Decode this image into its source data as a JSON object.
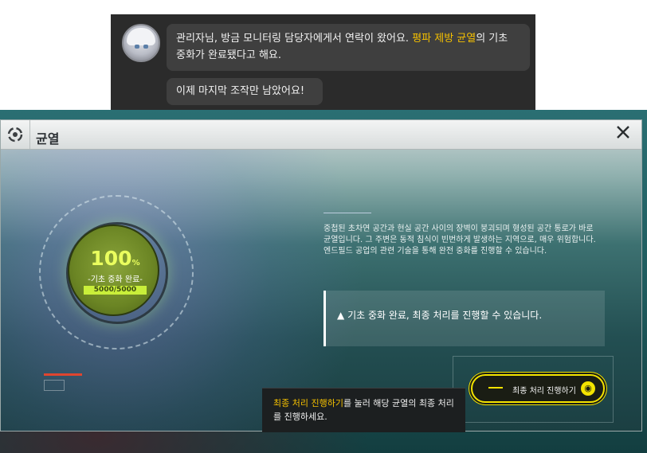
{
  "chat": {
    "message1_part1": "관리자님, 방금 모니터링 담당자에게서 연락이 왔어요. ",
    "message1_highlight": "평파 제방 균열",
    "message1_part2": "의 기초 중화가 완료됐다고 해요.",
    "message2": "이제 마지막 조작만 남았어요!"
  },
  "window": {
    "title": "균열",
    "logo_icon": "swirl-logo-icon",
    "close_icon": "close-icon"
  },
  "progress": {
    "percent_value": "100",
    "percent_sign": "%",
    "status_label": "-기초 중화 완료-",
    "counter": "5000/5000",
    "fraction": 1.0
  },
  "description": "중첩된 초차연 공간과 현실 공간 사이의 장벽이 붕괴되며 형성된 공간 통로가 바로 균열입니다. 그 주변은 동적 침식이 빈번하게 발생하는 지역으로, 매우 위험합니다. 엔드필드 공업의 관련 기술을 통해 완전 중화를 진행할 수 있습니다.",
  "notice": {
    "text": "기초 중화 완료, 최종 처리를 진행할 수 있습니다.",
    "icon": "warning-icon"
  },
  "final_button": {
    "label": "최종 처리 진행하기"
  },
  "tooltip": {
    "highlight": "최종 처리 진행하기",
    "text": "를 눌러 해당 균열의 최종 처리를 진행하세요."
  },
  "colors": {
    "accent_yellow": "#f3e300",
    "highlight_text": "#f5c000",
    "progress_green": "#c9ef3a"
  }
}
